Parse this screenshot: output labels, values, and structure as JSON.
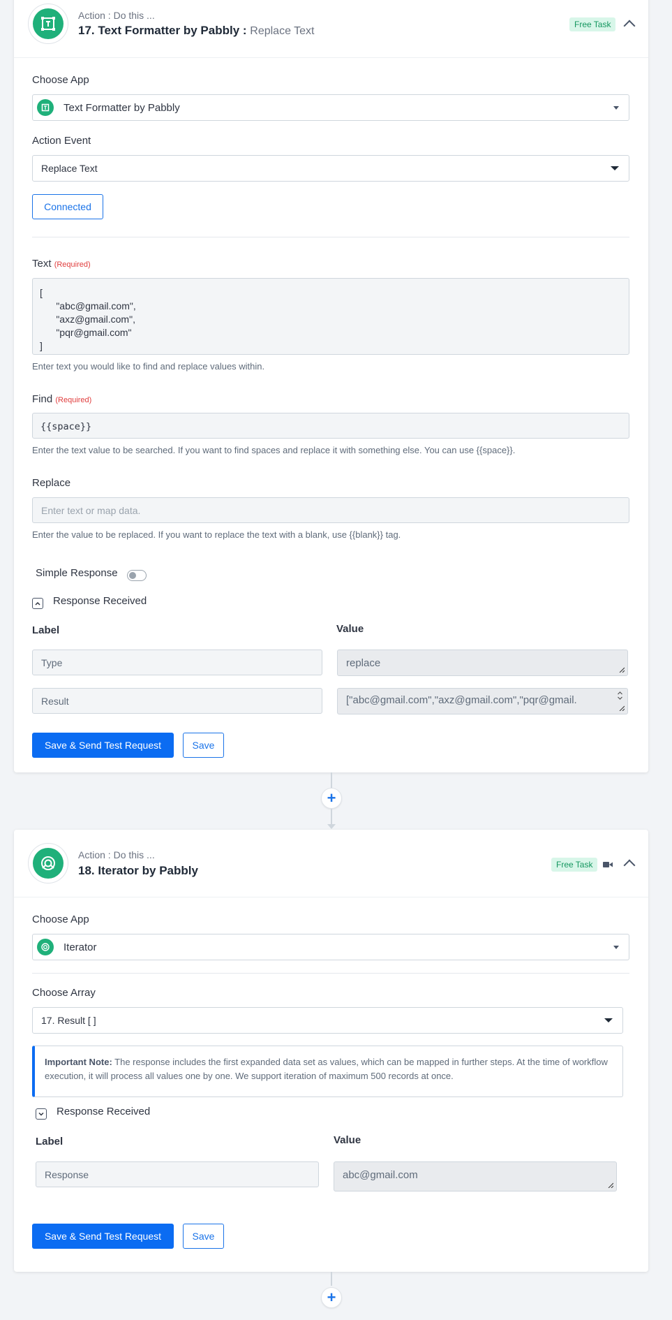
{
  "step17": {
    "action_label": "Action : Do this ...",
    "title": "17. Text Formatter by Pabbly :",
    "event_name": "Replace Text",
    "badge": "Free Task",
    "choose_app_label": "Choose App",
    "app_name": "Text Formatter by Pabbly",
    "action_event_label": "Action Event",
    "action_event_value": "Replace Text",
    "connected_label": "Connected",
    "text_label": "Text",
    "required": "(Required)",
    "text_value": "[\n      \"abc@gmail.com\",\n      \"axz@gmail.com\",\n      \"pqr@gmail.com\"\n]",
    "text_help": "Enter text you would like to find and replace values within.",
    "find_label": "Find",
    "find_value": "{{space}}",
    "find_help": "Enter the text value to be searched. If you want to find spaces and replace it with something else. You can use {{space}}.",
    "replace_label": "Replace",
    "replace_placeholder": "Enter text or map data.",
    "replace_help": "Enter the value to be replaced. If you want to replace the text with a blank, use {{blank}} tag.",
    "simple_response_label": "Simple Response",
    "simple_response_on": false,
    "response_received_label": "Response Received",
    "col_label": "Label",
    "col_value": "Value",
    "rows": [
      {
        "label": "Type",
        "value": "replace"
      },
      {
        "label": "Result",
        "value": "[\"abc@gmail.com\",\"axz@gmail.com\",\"pqr@gmail."
      }
    ],
    "save_send_label": "Save & Send Test Request",
    "save_label": "Save"
  },
  "step18": {
    "action_label": "Action : Do this ...",
    "title": "18. Iterator by Pabbly",
    "badge": "Free Task",
    "choose_app_label": "Choose App",
    "app_name": "Iterator",
    "choose_array_label": "Choose Array",
    "array_value": "17. Result [ ]",
    "note_bold": "Important Note:",
    "note_text": " The response includes the first expanded data set as values, which can be mapped in further steps. At the time of workflow execution, it will process all values one by one. We support iteration of maximum 500 records at once.",
    "response_received_label": "Response Received",
    "col_label": "Label",
    "col_value": "Value",
    "rows": [
      {
        "label": "Response",
        "value": "abc@gmail.com"
      }
    ],
    "save_send_label": "Save & Send Test Request",
    "save_label": "Save"
  },
  "colors": {
    "accent": "#0b6cf2",
    "app_green": "#1fb07a",
    "badge_bg": "#d8f6e9",
    "required": "#e03d3d"
  },
  "icons": [
    "text-formatter-icon",
    "iterator-icon",
    "chevron-up-icon",
    "chevron-down-icon",
    "caret-down-icon",
    "plus-icon",
    "video-icon"
  ]
}
